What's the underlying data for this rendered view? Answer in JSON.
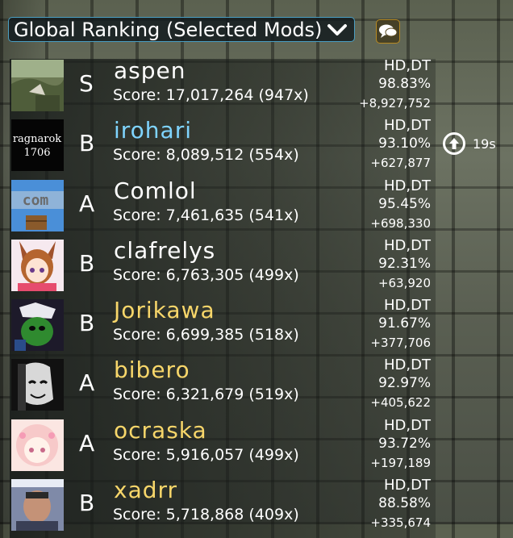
{
  "header": {
    "ranking_label": "Global Ranking (Selected Mods)"
  },
  "rank_change": {
    "label": "19s"
  },
  "entries": [
    {
      "rank": "S",
      "name": "aspen",
      "name_color": "#ffffff",
      "score": "Score: 17,017,264 (947x)",
      "mods": "HD,DT",
      "accuracy": "98.83%",
      "diff": "+8,927,752",
      "avatar": "landscape"
    },
    {
      "rank": "B",
      "name": "irohari",
      "name_color": "#7fd4ff",
      "score": "Score: 8,089,512 (554x)",
      "mods": "HD,DT",
      "accuracy": "93.10%",
      "diff": "+627,877",
      "avatar": "text"
    },
    {
      "rank": "A",
      "name": "Comlol",
      "name_color": "#ffffff",
      "score": "Score: 7,461,635 (541x)",
      "mods": "HD,DT",
      "accuracy": "95.45%",
      "diff": "+698,330",
      "avatar": "block"
    },
    {
      "rank": "B",
      "name": "clafrelys",
      "name_color": "#ffffff",
      "score": "Score: 6,763,305 (499x)",
      "mods": "HD,DT",
      "accuracy": "92.31%",
      "diff": "+63,920",
      "avatar": "anime1"
    },
    {
      "rank": "B",
      "name": "Jorikawa",
      "name_color": "#f7d66a",
      "score": "Score: 6,699,385 (518x)",
      "mods": "HD,DT",
      "accuracy": "91.67%",
      "diff": "+377,706",
      "avatar": "green"
    },
    {
      "rank": "A",
      "name": "bibero",
      "name_color": "#f7d66a",
      "score": "Score: 6,321,679 (519x)",
      "mods": "HD,DT",
      "accuracy": "92.97%",
      "diff": "+405,622",
      "avatar": "mono"
    },
    {
      "rank": "A",
      "name": "ocraska",
      "name_color": "#f7d66a",
      "score": "Score: 5,916,057 (499x)",
      "mods": "HD,DT",
      "accuracy": "93.72%",
      "diff": "+197,189",
      "avatar": "anime2"
    },
    {
      "rank": "B",
      "name": "xadrr",
      "name_color": "#f7d66a",
      "score": "Score: 5,718,868 (409x)",
      "mods": "HD,DT",
      "accuracy": "88.58%",
      "diff": "+335,674",
      "avatar": "photo"
    }
  ],
  "avatar_text": {
    "line1": "ragnarok",
    "line2": "1706",
    "block_word": "com"
  },
  "colors": {
    "accent_border": "#4a9ec2",
    "gold_name": "#f7d66a",
    "supporter_blue": "#7fd4ff"
  }
}
